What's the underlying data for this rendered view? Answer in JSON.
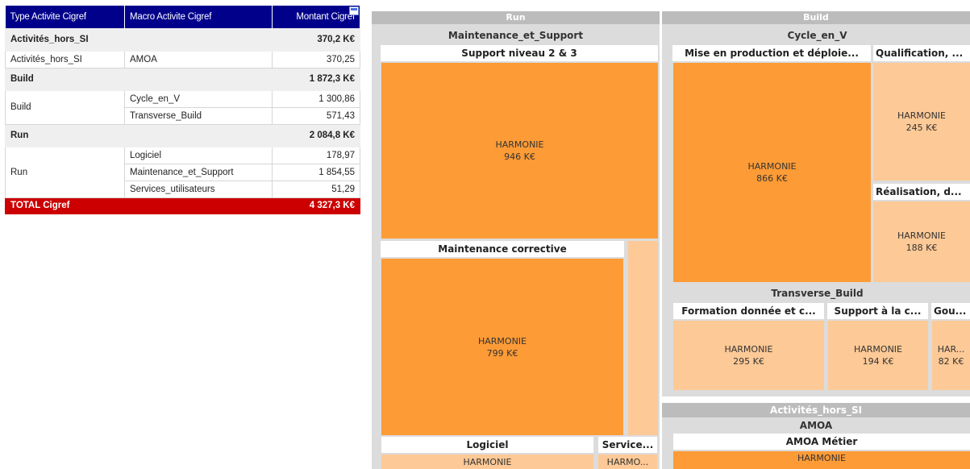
{
  "table": {
    "headers": [
      "Type Activite Cigref",
      "Macro Activite Cigref",
      "Montant Cigref"
    ],
    "groups": [
      {
        "label": "Activités_hors_SI",
        "total": "370,2 K€",
        "row_label": "Activités_hors_SI",
        "rows": [
          {
            "macro": "AMOA",
            "value": "370,25"
          }
        ]
      },
      {
        "label": "Build",
        "total": "1 872,3 K€",
        "row_label": "Build",
        "rows": [
          {
            "macro": "Cycle_en_V",
            "value": "1 300,86"
          },
          {
            "macro": "Transverse_Build",
            "value": "571,43"
          }
        ]
      },
      {
        "label": "Run",
        "total": "2 084,8 K€",
        "row_label": "Run",
        "rows": [
          {
            "macro": "Logiciel",
            "value": "178,97"
          },
          {
            "macro": "Maintenance_et_Support",
            "value": "1 854,55"
          },
          {
            "macro": "Services_utilisateurs",
            "value": "51,29"
          }
        ]
      }
    ],
    "total_label": "TOTAL Cigref",
    "total_value": "4 327,3 K€"
  },
  "treemap": {
    "run": {
      "title": "Run",
      "maintenance": {
        "title": "Maintenance_et_Support",
        "support": {
          "title": "Support niveau 2 & 3",
          "name": "HARMONIE",
          "value": "946 K€"
        },
        "corrective": {
          "title": "Maintenance corrective",
          "name": "HARMONIE",
          "value": "799 K€"
        }
      },
      "logiciel": {
        "title": "Logiciel",
        "name": "HARMONIE"
      },
      "services": {
        "title": "Service...",
        "name": "HARMO..."
      }
    },
    "build": {
      "title": "Build",
      "cycle": {
        "title": "Cycle_en_V",
        "mep": {
          "title": "Mise en production et déploie...",
          "name": "HARMONIE",
          "value": "866 K€"
        },
        "qualif": {
          "title": "Qualification, ...",
          "name": "HARMONIE",
          "value": "245 K€"
        },
        "realis": {
          "title": "Réalisation, d...",
          "name": "HARMONIE",
          "value": "188 K€"
        }
      },
      "transverse": {
        "title": "Transverse_Build",
        "formation": {
          "title": "Formation donnée et c...",
          "name": "HARMONIE",
          "value": "295 K€"
        },
        "support": {
          "title": "Support à la c...",
          "name": "HARMONIE",
          "value": "194 K€"
        },
        "gouv": {
          "title": "Gou...",
          "name": "HAR...",
          "value": "82 K€"
        }
      }
    },
    "hors_si": {
      "title": "Activités_hors_SI",
      "amoa": {
        "title": "AMOA",
        "metier": {
          "title": "AMOA Métier",
          "name": "HARMONIE"
        }
      }
    }
  },
  "colors": {
    "header_blue": "#00008b",
    "total_red": "#cc0000",
    "tile_dark": "#fd9b36",
    "tile_light": "#fdc996",
    "band_grey": "#bcbcbc"
  }
}
